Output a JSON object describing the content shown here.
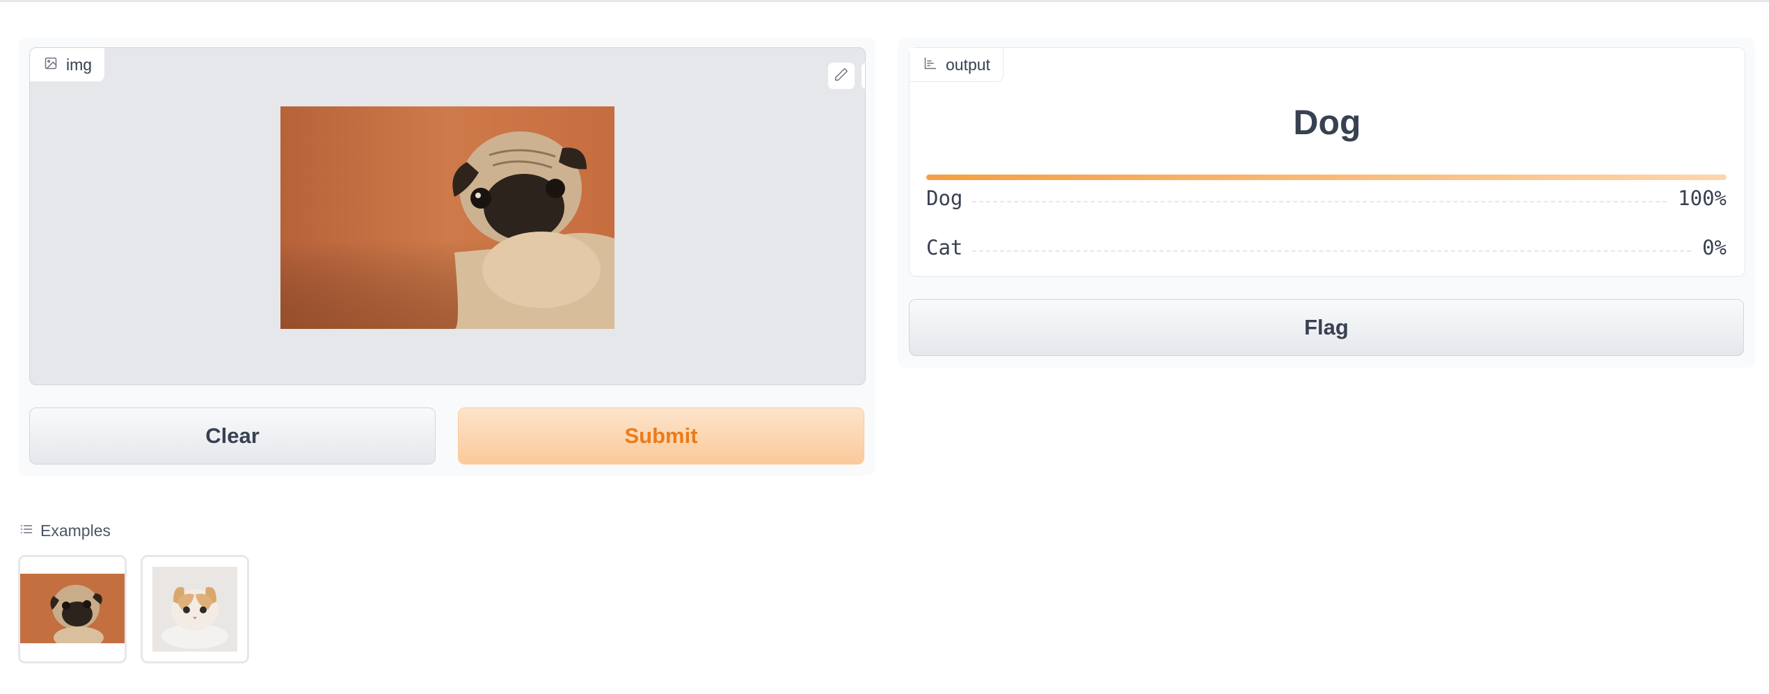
{
  "input": {
    "label": "img",
    "label_icon": "image-icon",
    "tools": [
      "edit-icon",
      "close-icon"
    ],
    "image_alt": "pug photo"
  },
  "buttons": {
    "clear": "Clear",
    "submit": "Submit",
    "flag": "Flag"
  },
  "output": {
    "label": "output",
    "label_icon": "bar-chart-icon",
    "prediction": "Dog",
    "confidences": [
      {
        "label": "Dog",
        "value": "100%",
        "fraction": 1.0
      },
      {
        "label": "Cat",
        "value": "0%",
        "fraction": 0.0
      }
    ],
    "top_fraction": 1.0
  },
  "examples": {
    "label": "Examples",
    "label_icon": "list-icon",
    "items": [
      "pug",
      "kitten"
    ]
  },
  "colors": {
    "accent": "#f59e42",
    "submit_text": "#ea7c1c"
  }
}
